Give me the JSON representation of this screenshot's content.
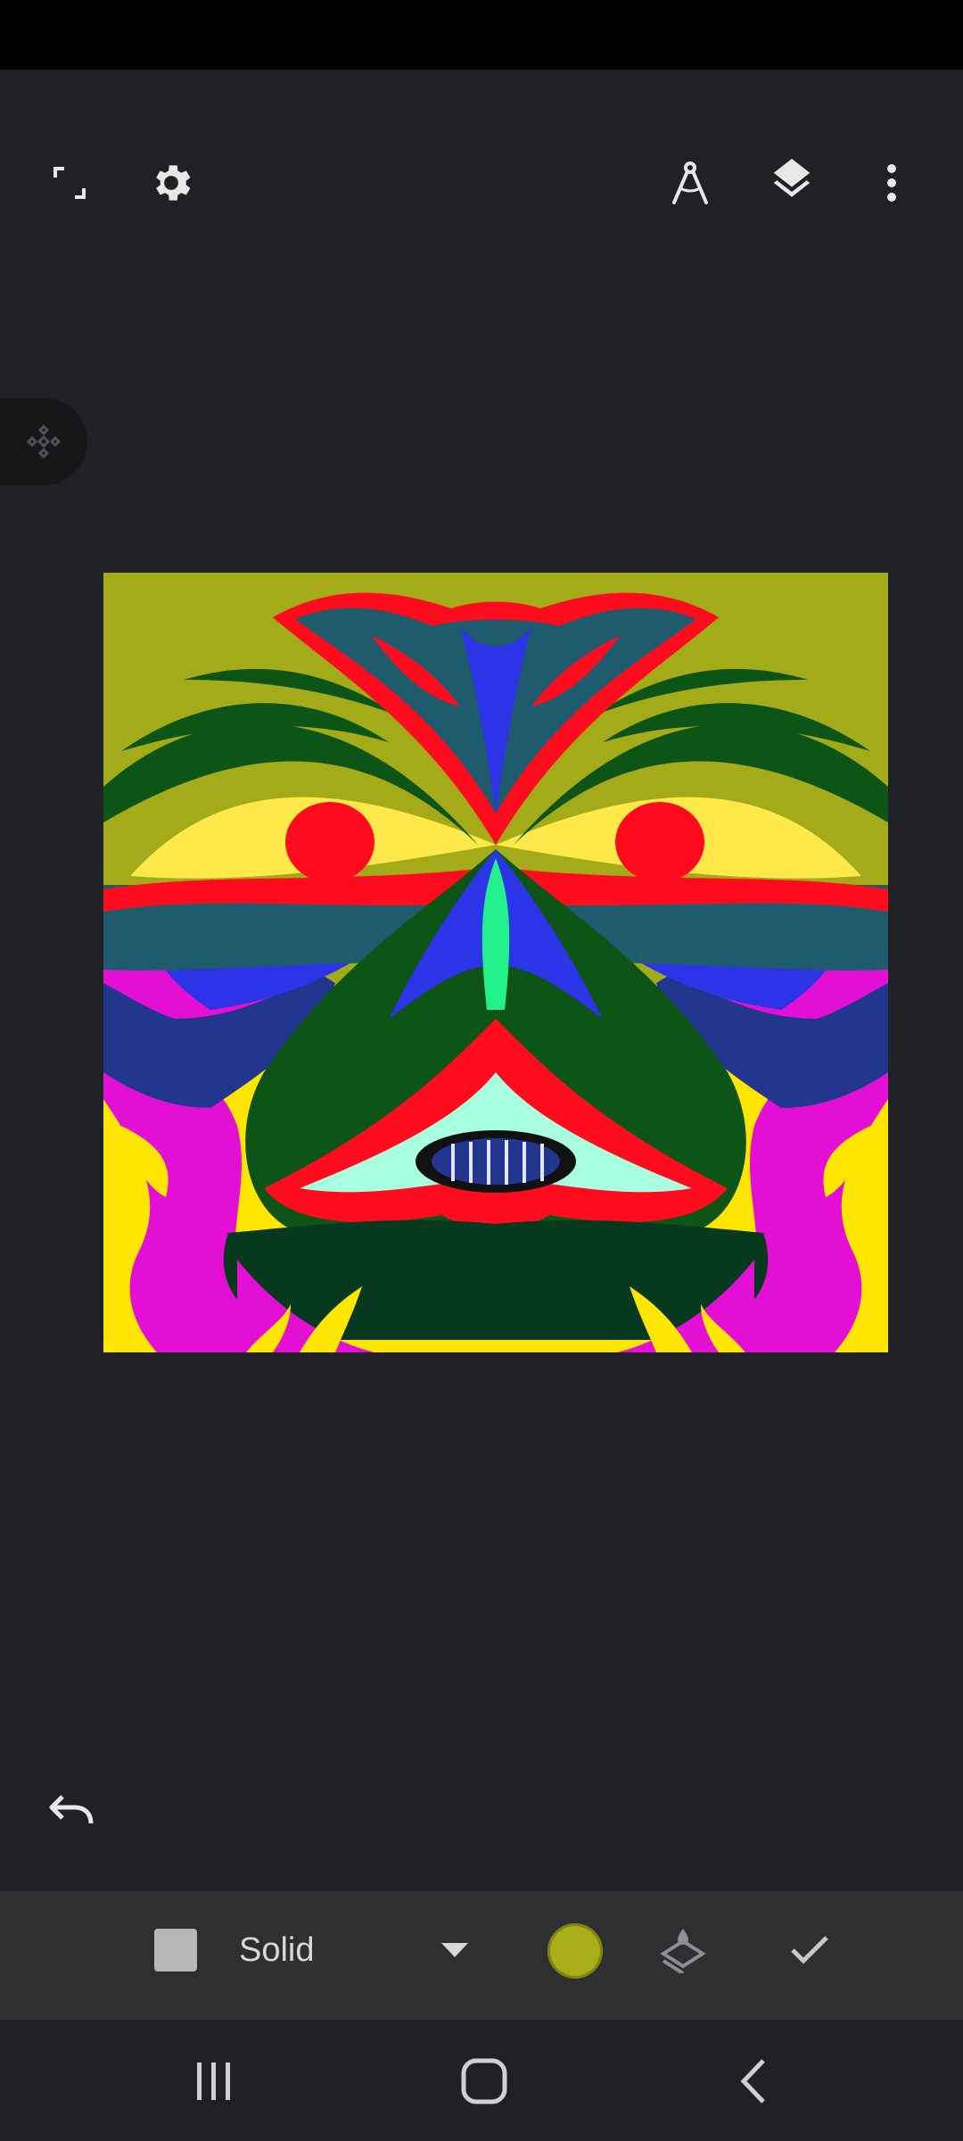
{
  "toolbar": {
    "icons": [
      "fullscreen-icon",
      "settings-icon",
      "ruler-compass-icon",
      "layers-icon",
      "more-vert-icon"
    ]
  },
  "side_panel": {
    "icon": "symmetry-guide-icon"
  },
  "canvas": {
    "background": "#a3ab18",
    "palette": [
      "#a3ab18",
      "#ff0b1e",
      "#1e5b6c",
      "#0d5517",
      "#ffe94a",
      "#2b34e6",
      "#22368f",
      "#e30fd4",
      "#ffe600",
      "#06391e",
      "#a8ffe0",
      "#22f08a"
    ]
  },
  "history": {
    "icon": "undo-icon"
  },
  "fill_tool": {
    "swatch_color": "#b7b7b7",
    "mode_label": "Solid",
    "dropdown_icon": "dropdown-arrow-icon",
    "selected_color": "#a8ad18",
    "layer_fill_icon": "layer-fill-icon",
    "confirm_icon": "check-icon"
  },
  "navigation": {
    "icons": [
      "recent-apps-icon",
      "home-icon",
      "back-icon"
    ]
  }
}
